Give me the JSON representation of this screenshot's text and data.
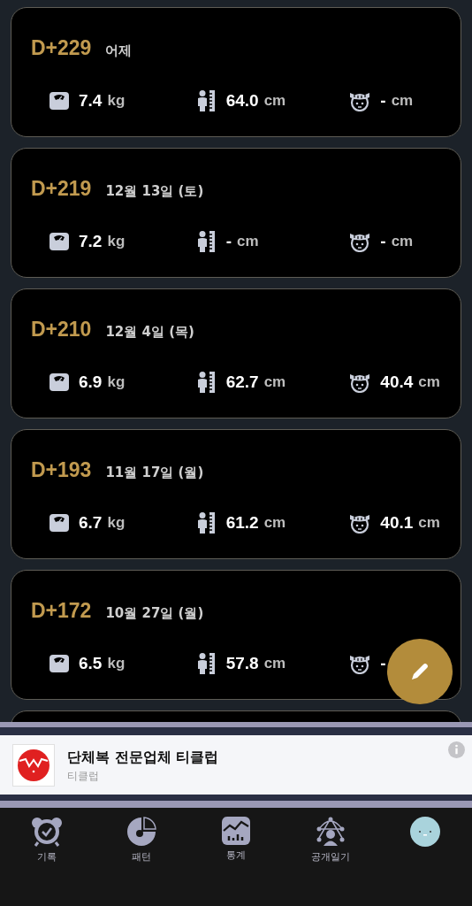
{
  "records": [
    {
      "day": "D+229",
      "date": "어제",
      "stats": [
        {
          "kind": "weight",
          "value": "7.4",
          "unit": "kg"
        },
        {
          "kind": "height",
          "value": "64.0",
          "unit": "cm"
        },
        {
          "kind": "head",
          "value": "-",
          "unit": "cm"
        }
      ]
    },
    {
      "day": "D+219",
      "date": "12월 13일 (토)",
      "stats": [
        {
          "kind": "weight",
          "value": "7.2",
          "unit": "kg"
        },
        {
          "kind": "height",
          "value": "-",
          "unit": "cm"
        },
        {
          "kind": "head",
          "value": "-",
          "unit": "cm"
        }
      ]
    },
    {
      "day": "D+210",
      "date": "12월 4일 (목)",
      "stats": [
        {
          "kind": "weight",
          "value": "6.9",
          "unit": "kg"
        },
        {
          "kind": "height",
          "value": "62.7",
          "unit": "cm"
        },
        {
          "kind": "head",
          "value": "40.4",
          "unit": "cm"
        }
      ]
    },
    {
      "day": "D+193",
      "date": "11월 17일 (월)",
      "stats": [
        {
          "kind": "weight",
          "value": "6.7",
          "unit": "kg"
        },
        {
          "kind": "height",
          "value": "61.2",
          "unit": "cm"
        },
        {
          "kind": "head",
          "value": "40.1",
          "unit": "cm"
        }
      ]
    },
    {
      "day": "D+172",
      "date": "10월 27일 (월)",
      "stats": [
        {
          "kind": "weight",
          "value": "6.5",
          "unit": "kg"
        },
        {
          "kind": "height",
          "value": "57.8",
          "unit": "cm"
        },
        {
          "kind": "head",
          "value": "-"
        }
      ]
    },
    {
      "kind": "partial"
    }
  ],
  "ad": {
    "title": "단체복 전문업체 티클럽",
    "advertiser": "티클럽"
  },
  "tabs": [
    {
      "kind": "record",
      "label": "기록"
    },
    {
      "kind": "pattern",
      "label": "패턴"
    },
    {
      "kind": "stats",
      "label": "통계"
    },
    {
      "kind": "public",
      "label": "공개일기"
    },
    {
      "kind": "profile"
    }
  ]
}
